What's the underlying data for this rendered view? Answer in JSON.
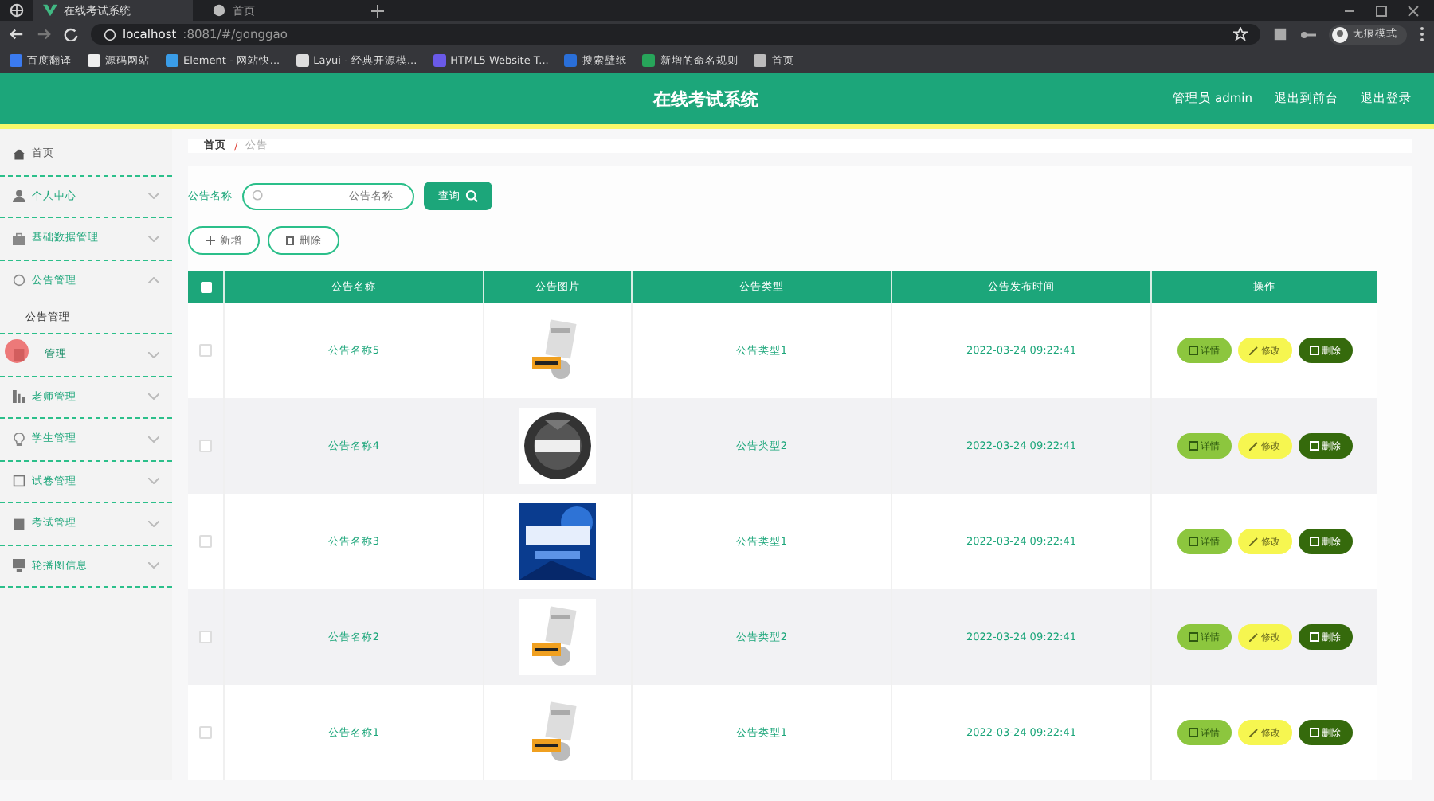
{
  "browser": {
    "tabs": [
      {
        "title": "在线考试系统",
        "selected": true
      },
      {
        "title": "首页",
        "selected": false
      }
    ],
    "address": {
      "host": "localhost",
      "rest": ":8081/#/gonggao"
    },
    "bookmarks": [
      "百度翻译",
      "源码网站",
      "Element - 网站快...",
      "Layui - 经典开源模...",
      "HTML5 Website T...",
      "搜索壁纸",
      "新增的命名规则",
      "首页"
    ],
    "profile": "无痕模式"
  },
  "header": {
    "title": "在线考试系统",
    "links": [
      "管理员 admin",
      "退出到前台",
      "退出登录"
    ]
  },
  "sidebar": {
    "items": [
      {
        "label": "首页",
        "has_arrow": false,
        "expanded": false,
        "cursor": false
      },
      {
        "label": "个人中心",
        "has_arrow": true,
        "expanded": false,
        "cursor": false
      },
      {
        "label": "基础数据管理",
        "has_arrow": true,
        "expanded": false,
        "cursor": false
      },
      {
        "label": "公告管理",
        "has_arrow": true,
        "expanded": true,
        "cursor": false,
        "children": [
          {
            "label": "公告管理"
          }
        ]
      },
      {
        "label": "管理",
        "has_arrow": true,
        "expanded": false,
        "cursor": true
      },
      {
        "label": "老师管理",
        "has_arrow": true,
        "expanded": false,
        "cursor": false
      },
      {
        "label": "学生管理",
        "has_arrow": true,
        "expanded": false,
        "cursor": false
      },
      {
        "label": "试卷管理",
        "has_arrow": true,
        "expanded": false,
        "cursor": false
      },
      {
        "label": "考试管理",
        "has_arrow": true,
        "expanded": false,
        "cursor": false
      },
      {
        "label": "轮播图信息",
        "has_arrow": true,
        "expanded": false,
        "cursor": false
      }
    ]
  },
  "breadcrumb": {
    "items": [
      "首页",
      "公告"
    ],
    "separator": "/"
  },
  "search": {
    "label": "公告名称",
    "placeholder": "公告名称",
    "button": "查询"
  },
  "toolbar": [
    "新增",
    "删除"
  ],
  "table": {
    "columns": [
      "公告名称",
      "公告图片",
      "公告类型",
      "公告发布时间",
      "操作"
    ],
    "all_checked": false,
    "rows": [
      {
        "name": "公告名称5",
        "type": "公告类型1",
        "time": "2022-03-24 09:22:41",
        "checked": false,
        "actions": [
          {
            "kind": "detail",
            "label": "详情"
          },
          {
            "kind": "edit",
            "label": "修改"
          },
          {
            "kind": "delete",
            "label": "删除"
          }
        ]
      },
      {
        "name": "公告名称4",
        "type": "公告类型2",
        "time": "2022-03-24 09:22:41",
        "checked": false,
        "actions": [
          {
            "kind": "detail",
            "label": "详情"
          },
          {
            "kind": "edit",
            "label": "修改"
          },
          {
            "kind": "delete",
            "label": "删除"
          }
        ]
      },
      {
        "name": "公告名称3",
        "type": "公告类型1",
        "time": "2022-03-24 09:22:41",
        "checked": false,
        "actions": [
          {
            "kind": "detail",
            "label": "详情"
          },
          {
            "kind": "edit",
            "label": "修改"
          },
          {
            "kind": "delete",
            "label": "删除"
          }
        ]
      },
      {
        "name": "公告名称2",
        "type": "公告类型2",
        "time": "2022-03-24 09:22:41",
        "checked": false,
        "actions": [
          {
            "kind": "detail",
            "label": "详情"
          },
          {
            "kind": "edit",
            "label": "修改"
          },
          {
            "kind": "delete",
            "label": "删除"
          }
        ]
      },
      {
        "name": "公告名称1",
        "type": "公告类型1",
        "time": "2022-03-24 09:22:41",
        "checked": false,
        "actions": [
          {
            "kind": "detail",
            "label": "详情"
          },
          {
            "kind": "edit",
            "label": "修改"
          },
          {
            "kind": "delete",
            "label": "删除"
          }
        ]
      }
    ]
  }
}
